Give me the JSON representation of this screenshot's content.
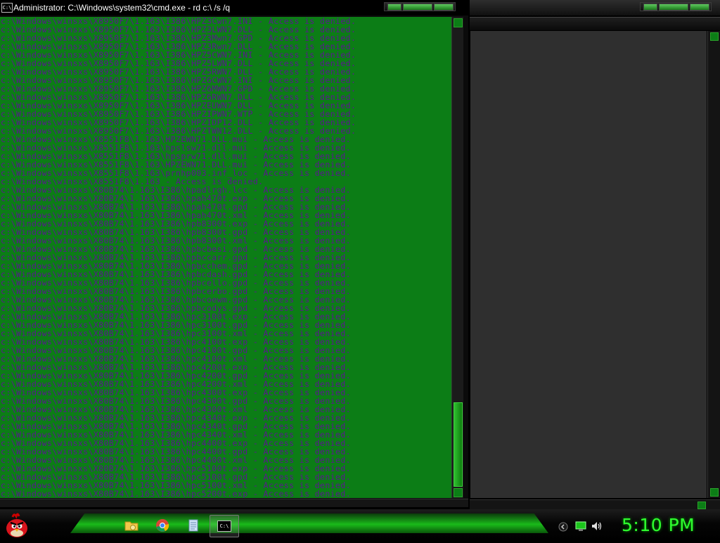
{
  "cmd": {
    "title": "Administrator: C:\\Windows\\system32\\cmd.exe - rd  c:\\ /s /q",
    "icon_text": "C:\\",
    "lines": [
      "c:\\Windows\\winsxs\\X8950F7\\1.163\\I386\\HPZ3Cwn7.INI - Access is denied.",
      "c:\\Windows\\winsxs\\X8950F7\\1.163\\I386\\HPZ3LWN7.DLL - Access is denied.",
      "c:\\Windows\\winsxs\\X8950F7\\1.163\\I386\\HPZ3Mwn7.GPD - Access is denied.",
      "c:\\Windows\\winsxs\\X8950F7\\1.163\\I386\\HPZ3Rwn7.DLL - Access is denied.",
      "c:\\Windows\\winsxs\\X8950F7\\1.163\\I386\\HPZ5CWN7.INI - Access is denied.",
      "c:\\Windows\\winsxs\\X8950F7\\1.163\\I386\\HPZ5LWN7.DLL - Access is denied.",
      "c:\\Windows\\winsxs\\X8950F7\\1.163\\I386\\HPZ5RWN7.DLL - Access is denied.",
      "c:\\Windows\\winsxs\\X8950F7\\1.163\\I386\\HPZ6CWN7.INI - Access is denied.",
      "c:\\Windows\\winsxs\\X8950F7\\1.163\\I386\\HPZ6MWN7.GPD - Access is denied.",
      "c:\\Windows\\winsxs\\X8950F7\\1.163\\I386\\HPZ6RWN7.DLL - Access is denied.",
      "c:\\Windows\\winsxs\\X8950F7\\1.163\\I386\\HPZEUWN7.DLL - Access is denied.",
      "c:\\Windows\\winsxs\\X8950F7\\1.163\\I386\\HPZIPWN7.WTP - Access is denied.",
      "c:\\Windows\\winsxs\\X8950F7\\1.163\\I386\\HPZIDP12.DLL - Access is denied.",
      "c:\\Windows\\winsxs\\X8950F7\\1.163\\I386\\HPZTWN12.DLL - Access is denied.",
      "c:\\Windows\\winsxs\\X8551F8\\1.163\\HPZEWN71.DLL.mui - Access is denied.",
      "c:\\Windows\\winsxs\\X8551F8\\1.163\\hpslsw71.dll.mui - Access is denied.",
      "c:\\Windows\\winsxs\\X8551F8\\1.163\\hpsprw71.dll.mui - Access is denied.",
      "c:\\Windows\\winsxs\\X8551F8\\1.163\\HPZEWN71.DLL.mui - Access is denied.",
      "c:\\Windows\\winsxs\\X8551F8\\1.163\\prnhp003.inf_loc - Access is denied.",
      "c:\\Windows\\winsxs\\X8551F8\\1.163 - Access is denied.",
      "c:\\Windows\\winsxs\\X80B74\\1.163\\I386\\hpadlrgh.lcc - Access is denied.",
      "c:\\Windows\\winsxs\\X80B74\\1.163\\I386\\hpah470t.exp - Access is denied.",
      "c:\\Windows\\winsxs\\X80B74\\1.163\\I386\\hpah470t.gpd - Access is denied.",
      "c:\\Windows\\winsxs\\X80B74\\1.163\\I386\\hpah470t.xml - Access is denied.",
      "c:\\Windows\\winsxs\\X80B74\\1.163\\I386\\hpb8300t.exp - Access is denied.",
      "c:\\Windows\\winsxs\\X80B74\\1.163\\I386\\hpb8300t.gpd - Access is denied.",
      "c:\\Windows\\winsxs\\X80B74\\1.163\\I386\\hpb8300t.xml - Access is denied.",
      "c:\\Windows\\winsxs\\X80B74\\1.163\\I386\\hpbcbesi.gpd - Access is denied.",
      "c:\\Windows\\winsxs\\X80B74\\1.163\\I386\\hpbccarr.gpd - Access is denied.",
      "c:\\Windows\\winsxs\\X80B74\\1.163\\I386\\hpbcchem.gpd - Access is denied.",
      "c:\\Windows\\winsxs\\X80B74\\1.163\\I386\\hpbcdash.gpd - Access is denied.",
      "c:\\Windows\\winsxs\\X80B74\\1.163\\I386\\hpbcello.gpd - Access is denied.",
      "c:\\Windows\\winsxs\\X80B74\\1.163\\I386\\hpbcerbo.gpd - Access is denied.",
      "c:\\Windows\\winsxs\\X80B74\\1.163\\I386\\hpbcoewm.gpd - Access is denied.",
      "c:\\Windows\\winsxs\\X80B74\\1.163\\I386\\hpbcodys.gpd - Access is denied.",
      "c:\\Windows\\winsxs\\X80B74\\1.163\\I386\\hpc3100t.exp - Access is denied.",
      "c:\\Windows\\winsxs\\X80B74\\1.163\\I386\\hpc3100t.gpd - Access is denied.",
      "c:\\Windows\\winsxs\\X80B74\\1.163\\I386\\hpc3100t.xml - Access is denied.",
      "c:\\Windows\\winsxs\\X80B74\\1.163\\I386\\hpc4100t.exp - Access is denied.",
      "c:\\Windows\\winsxs\\X80B74\\1.163\\I386\\hpc4100t.gpd - Access is denied.",
      "c:\\Windows\\winsxs\\X80B74\\1.163\\I386\\hpc4100t.xml - Access is denied.",
      "c:\\Windows\\winsxs\\X80B74\\1.163\\I386\\hpc4200t.exp - Access is denied.",
      "c:\\Windows\\winsxs\\X80B74\\1.163\\I386\\hpc4200t.gpd - Access is denied.",
      "c:\\Windows\\winsxs\\X80B74\\1.163\\I386\\hpc4200t.xml - Access is denied.",
      "c:\\Windows\\winsxs\\X80B74\\1.163\\I386\\hpc4300t.exp - Access is denied.",
      "c:\\Windows\\winsxs\\X80B74\\1.163\\I386\\hpc4300t.gpd - Access is denied.",
      "c:\\Windows\\winsxs\\X80B74\\1.163\\I386\\hpc4300t.xml - Access is denied.",
      "c:\\Windows\\winsxs\\X80B74\\1.163\\I386\\hpc4340t.exp - Access is denied.",
      "c:\\Windows\\winsxs\\X80B74\\1.163\\I386\\hpc4340t.gpd - Access is denied.",
      "c:\\Windows\\winsxs\\X80B74\\1.163\\I386\\hpc4340t.xml - Access is denied.",
      "c:\\Windows\\winsxs\\X80B74\\1.163\\I386\\hpc4400t.exp - Access is denied.",
      "c:\\Windows\\winsxs\\X80B74\\1.163\\I386\\hpc4400t.gpd - Access is denied.",
      "c:\\Windows\\winsxs\\X80B74\\1.163\\I386\\hpc4400t.xml - Access is denied.",
      "c:\\Windows\\winsxs\\X80B74\\1.163\\I386\\hpc5100t.exp - Access is denied.",
      "c:\\Windows\\winsxs\\X80B74\\1.163\\I386\\hpc5100t.gpd - Access is denied.",
      "c:\\Windows\\winsxs\\X80B74\\1.163\\I386\\hpc5100t.xml - Access is denied.",
      "c:\\Windows\\winsxs\\X80B74\\1.163\\I386\\hpc5200t.exp - Access is denied."
    ]
  },
  "taskbar": {
    "clock": "5:10 PM",
    "pinned": [
      {
        "name": "explorer-icon"
      },
      {
        "name": "chrome-icon"
      },
      {
        "name": "notepad-icon"
      }
    ],
    "cmd_icon_text": "C:\\",
    "tray": [
      {
        "name": "show-hidden-icons-icon"
      },
      {
        "name": "network-icon"
      },
      {
        "name": "volume-icon"
      }
    ]
  },
  "colors": {
    "console_background": "#0c7d16",
    "console_text": "#5a1790",
    "clock": "#2fff2f",
    "accent": "#1bc41b"
  }
}
